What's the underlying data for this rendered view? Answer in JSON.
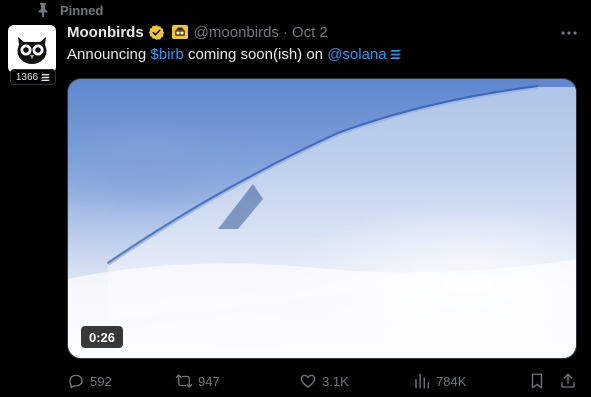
{
  "pinned": {
    "label": "Pinned",
    "icon": "pin-icon"
  },
  "author": {
    "display_name": "Moonbirds",
    "handle": "@moonbirds",
    "separator": "·",
    "date": "Oct 2",
    "avatar_badge_count": "1366",
    "verified_color": "#f4c431"
  },
  "tweet": {
    "text_before": "Announcing",
    "cashtag": "$birb",
    "text_middle": "coming soon(ish) on",
    "mention": "@solana",
    "link_color": "#1d9bf0"
  },
  "media": {
    "type": "video",
    "duration": "0:26"
  },
  "actions": {
    "replies": "592",
    "reposts": "947",
    "likes": "3.1K",
    "views": "784K"
  },
  "colors": {
    "background": "#000000",
    "text": "#e7e9ea",
    "muted": "#71767b",
    "border": "#2f3336"
  }
}
